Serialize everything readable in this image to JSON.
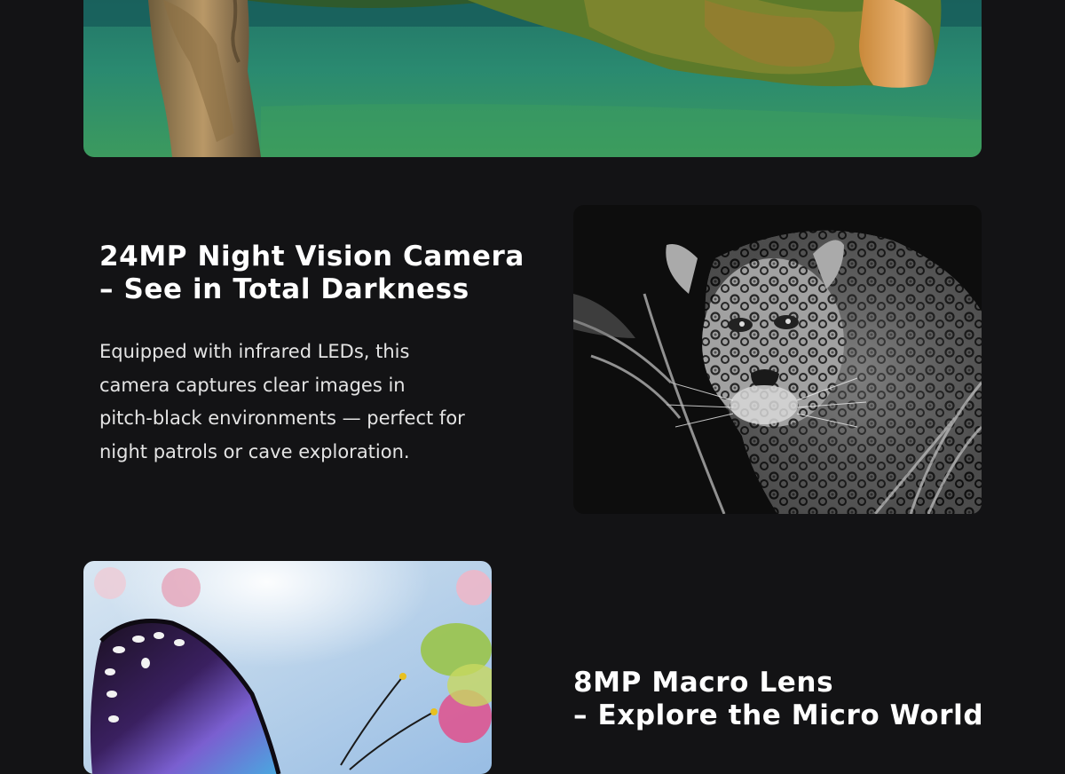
{
  "page": {
    "background": "#131315"
  },
  "images": {
    "top": {
      "name": "island-lagoon-aerial-photo"
    },
    "leopard": {
      "name": "night-vision-leopard-photo"
    },
    "butterfly": {
      "name": "macro-butterfly-photo"
    }
  },
  "night_vision": {
    "title_line1": "24MP Night Vision Camera",
    "title_line2": "– See in Total Darkness",
    "desc_lines": [
      "Equipped with infrared LEDs, this",
      "camera captures clear images in",
      "pitch-black environments — perfect for",
      "night patrols or cave exploration."
    ]
  },
  "macro": {
    "title_line1": "8MP Macro Lens",
    "title_line2": "– Explore the Micro World"
  }
}
